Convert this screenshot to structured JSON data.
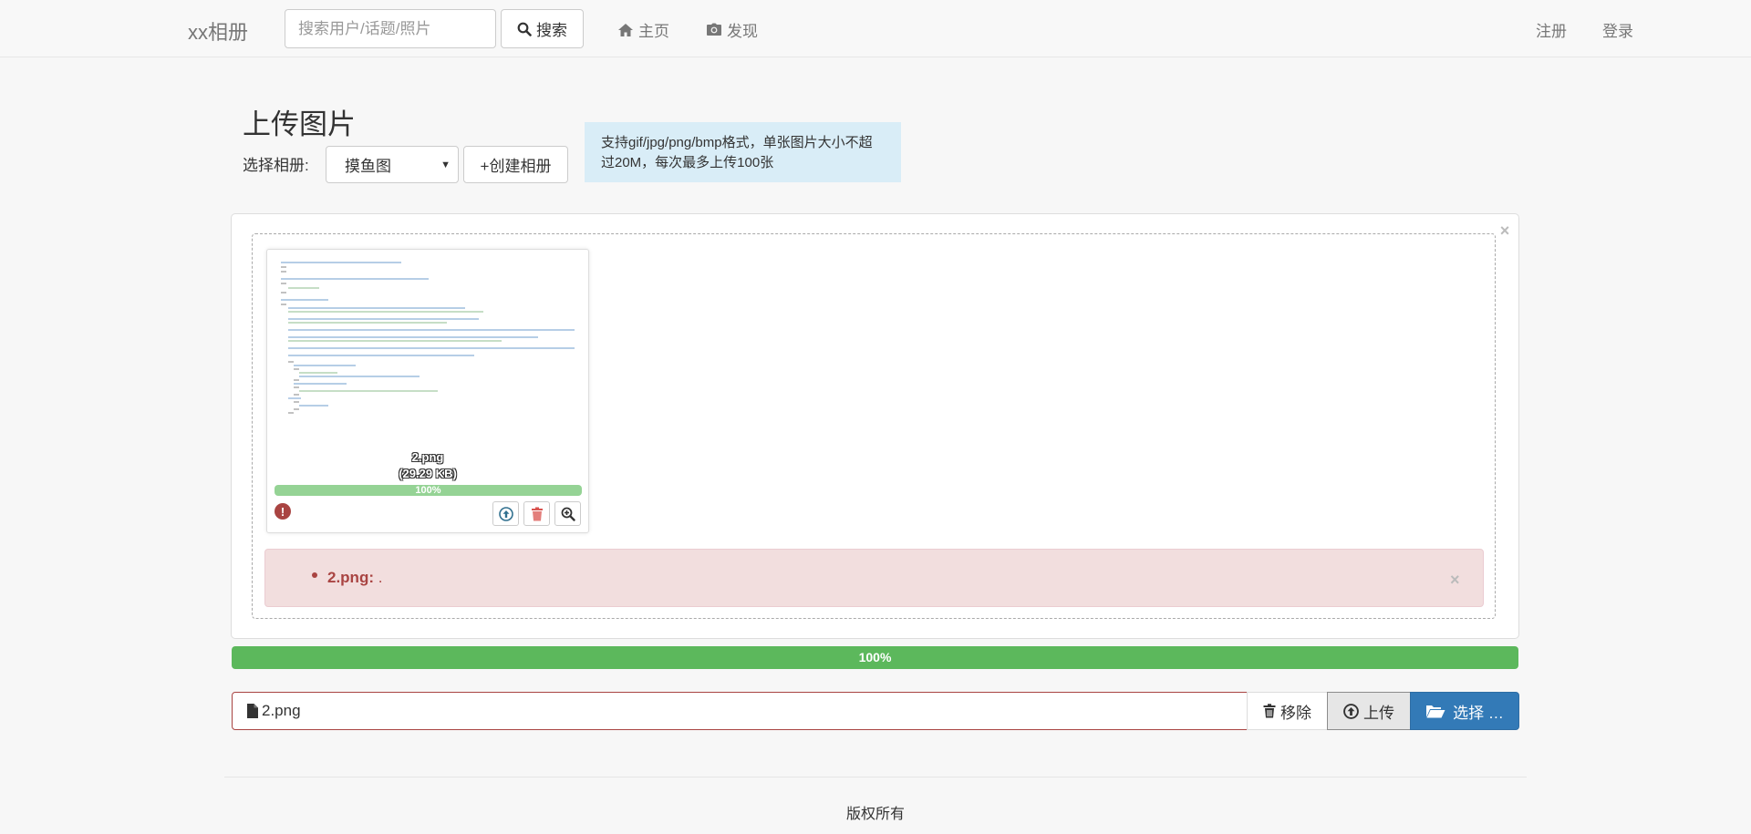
{
  "navbar": {
    "brand": "xx相册",
    "search_placeholder": "搜索用户/话题/照片",
    "search_button": "搜索",
    "home": "主页",
    "discover": "发现",
    "register": "注册",
    "login": "登录"
  },
  "upload": {
    "title": "上传图片",
    "album_label": "选择相册:",
    "album_selected": "摸鱼图",
    "create_album": "+创建相册",
    "info": "支持gif/jpg/png/bmp格式，单张图片大小不超过20M，每次最多上传100张"
  },
  "preview": {
    "file_name": "2.png",
    "file_size": "(29.29 KB)",
    "progress_label": "100%",
    "progress_fraction": 1.0,
    "error_file": "2.png:",
    "error_message": "."
  },
  "overall_progress": {
    "label": "100%",
    "fraction": 1.0
  },
  "file_input": {
    "caption": "2.png",
    "remove": "移除",
    "upload": "上传",
    "browse": "选择 …"
  },
  "footer": {
    "text": "版权所有"
  },
  "colors": {
    "primary": "#337ab7",
    "success": "#5cb85c",
    "danger_text": "#a94442",
    "danger_bg": "#f2dede",
    "info_bg": "#d9edf7"
  }
}
